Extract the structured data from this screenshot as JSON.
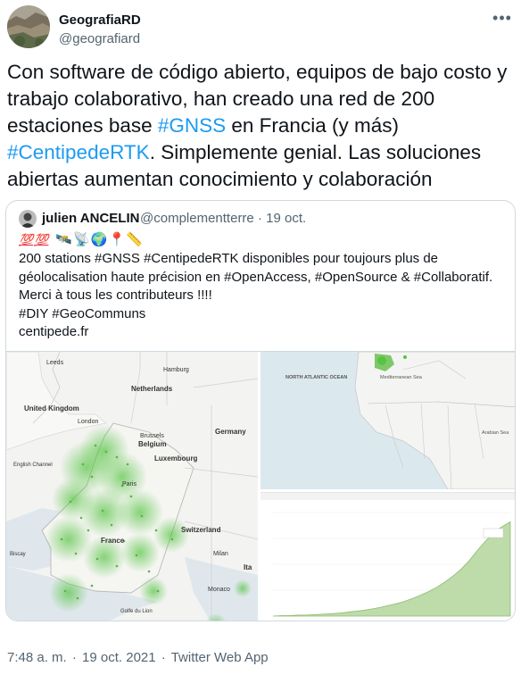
{
  "author": {
    "display_name": "GeografiaRD",
    "handle": "@geografiard"
  },
  "tweet": {
    "segments": [
      {
        "text": "Con software de código abierto, equipos de bajo costo y trabajo colaborativo, han creado una red de 200 estaciones base ",
        "link": false
      },
      {
        "text": "#GNSS",
        "link": true
      },
      {
        "text": " en Francia (y más) ",
        "link": false
      },
      {
        "text": "#CentipedeRTK",
        "link": true
      },
      {
        "text": ". Simplemente genial. Las soluciones abiertas aumentan conocimiento y colaboración",
        "link": false
      }
    ]
  },
  "quote": {
    "display_name": "julien ANCELIN",
    "handle": "@complementterre",
    "separator": "·",
    "date": "19 oct.",
    "emoji_100": "💯",
    "emojis": [
      "🛰️",
      "📡",
      "🌍",
      "📍",
      "📏"
    ],
    "lines": [
      "200 stations #GNSS #CentipedeRTK disponibles pour toujours plus de",
      "géolocalisation haute précision en #OpenAccess, #OpenSource & #Collaboratif.",
      "Merci à tous les contributeurs !!!!",
      "#DIY #GeoCommuns",
      "centipede.fr"
    ]
  },
  "map_left": {
    "labels": {
      "hamburg": "Hamburg",
      "leeds": "Leeds",
      "netherlands": "Netherlands",
      "united_kingdom": "United Kingdom",
      "london": "London",
      "brussels": "Brussels",
      "belgium": "Belgium",
      "germany": "Germany",
      "luxembourg": "Luxembourg",
      "english_channel": "English Channel",
      "paris": "Paris",
      "france": "France",
      "switzerland": "Switzerland",
      "milan": "Milan",
      "monaco": "Monaco",
      "golfe": "Golfe du Lion",
      "biscay": "Biscay",
      "ita": "Ita"
    }
  },
  "map_right": {
    "labels": {
      "ocean": "NORTH ATLANTIC OCEAN",
      "med": "Mediterranean Sea",
      "arabian": "Arabian Sea"
    }
  },
  "chart_data": {
    "type": "area",
    "title": "",
    "xlabel": "",
    "ylabel": "",
    "series": [
      {
        "values": [
          0,
          1,
          1,
          2,
          2,
          3,
          4,
          5,
          6,
          8,
          10,
          12,
          15,
          18,
          22,
          26,
          31,
          37,
          44,
          52,
          61,
          72,
          85,
          100,
          118,
          140,
          160,
          178,
          190,
          200
        ]
      }
    ],
    "ylim": [
      0,
      220
    ],
    "color": "#a8cf8e"
  },
  "footer": {
    "time": "7:48 a. m.",
    "separator": "·",
    "date": "19 oct. 2021",
    "source": "Twitter Web App"
  },
  "colors": {
    "link": "#1d9bf0",
    "text": "#0f1419",
    "muted": "#536471",
    "heat": "#56c443"
  }
}
